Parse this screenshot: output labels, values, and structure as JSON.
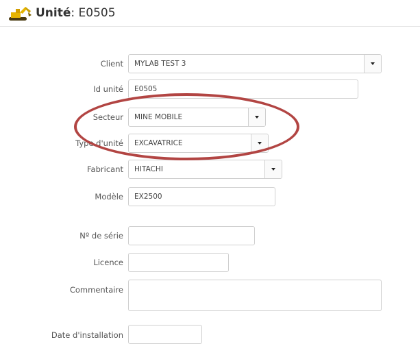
{
  "header": {
    "icon": "excavator-icon",
    "title_label": "Unité",
    "title_value": ": E0505"
  },
  "form": {
    "client": {
      "label": "Client",
      "value": "MYLAB TEST 3"
    },
    "id_unite": {
      "label": "Id unité",
      "value": "E0505"
    },
    "secteur": {
      "label": "Secteur",
      "value": "MINE MOBILE"
    },
    "type_unite": {
      "label": "Type d'unité",
      "value": "EXCAVATRICE"
    },
    "fabricant": {
      "label": "Fabricant",
      "value": "HITACHI"
    },
    "modele": {
      "label": "Modèle",
      "value": "EX2500"
    },
    "numero_serie": {
      "label": "Nº de série",
      "value": ""
    },
    "licence": {
      "label": "Licence",
      "value": ""
    },
    "commentaire": {
      "label": "Commentaire",
      "value": ""
    },
    "date_installation": {
      "label": "Date d'installation",
      "value": ""
    }
  },
  "annotation": {
    "color": "#b24543"
  }
}
